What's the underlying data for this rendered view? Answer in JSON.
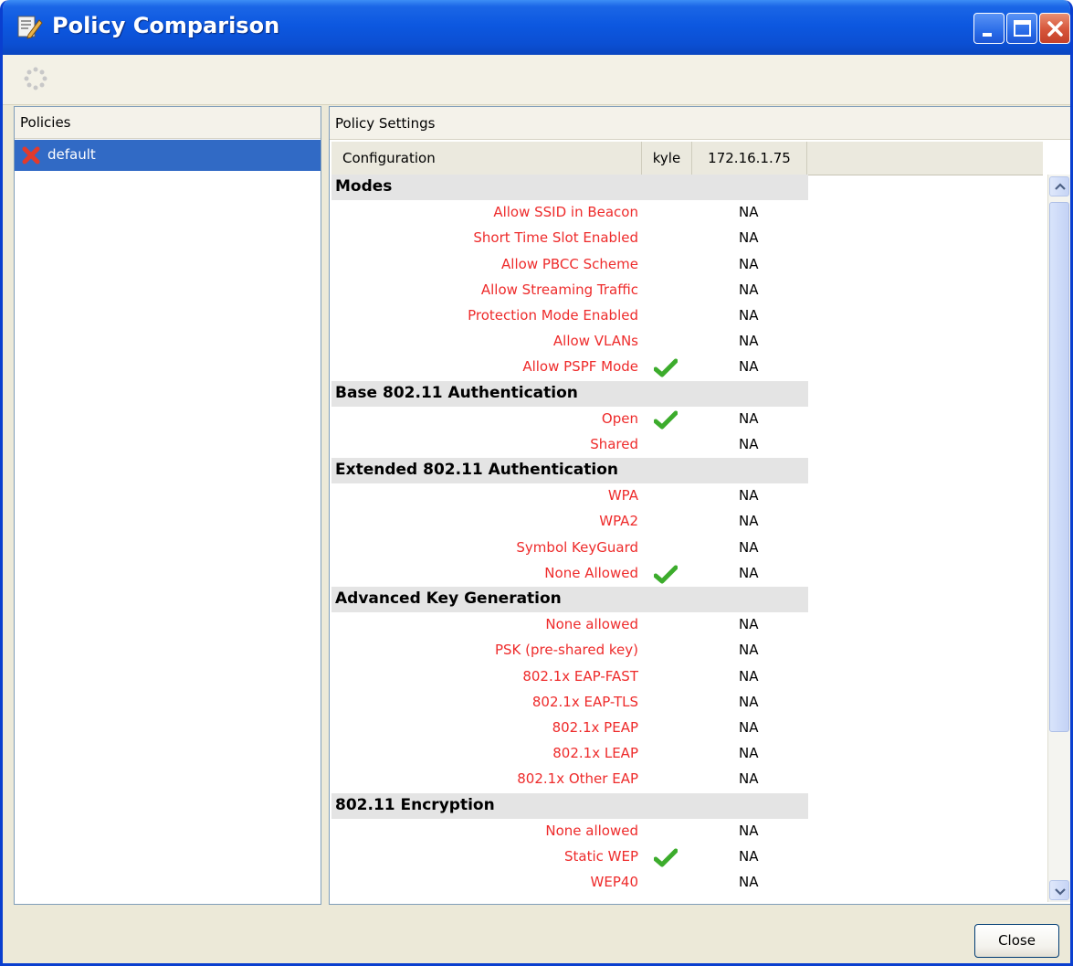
{
  "window": {
    "title": "Policy Comparison"
  },
  "left_pane": {
    "header": "Policies",
    "policies": [
      {
        "label": "default",
        "icon": "red-x-icon",
        "selected": true
      }
    ]
  },
  "right_pane": {
    "header": "Policy Settings",
    "columns": [
      "Configuration",
      "kyle",
      "172.16.1.75"
    ]
  },
  "sections": [
    {
      "title": "Modes",
      "items": [
        {
          "name": "Allow SSID in Beacon",
          "kyle": false,
          "value": "NA"
        },
        {
          "name": "Short Time Slot Enabled",
          "kyle": false,
          "value": "NA"
        },
        {
          "name": "Allow PBCC Scheme",
          "kyle": false,
          "value": "NA"
        },
        {
          "name": "Allow Streaming Traffic",
          "kyle": false,
          "value": "NA"
        },
        {
          "name": "Protection Mode Enabled",
          "kyle": false,
          "value": "NA"
        },
        {
          "name": "Allow VLANs",
          "kyle": false,
          "value": "NA"
        },
        {
          "name": "Allow PSPF Mode",
          "kyle": true,
          "value": "NA"
        }
      ]
    },
    {
      "title": "Base 802.11 Authentication",
      "items": [
        {
          "name": "Open",
          "kyle": true,
          "value": "NA"
        },
        {
          "name": "Shared",
          "kyle": false,
          "value": "NA"
        }
      ]
    },
    {
      "title": "Extended 802.11 Authentication",
      "items": [
        {
          "name": "WPA",
          "kyle": false,
          "value": "NA"
        },
        {
          "name": "WPA2",
          "kyle": false,
          "value": "NA"
        },
        {
          "name": "Symbol KeyGuard",
          "kyle": false,
          "value": "NA"
        },
        {
          "name": "None Allowed",
          "kyle": true,
          "value": "NA"
        }
      ]
    },
    {
      "title": "Advanced Key Generation",
      "items": [
        {
          "name": "None allowed",
          "kyle": false,
          "value": "NA"
        },
        {
          "name": "PSK (pre-shared key)",
          "kyle": false,
          "value": "NA"
        },
        {
          "name": "802.1x EAP-FAST",
          "kyle": false,
          "value": "NA"
        },
        {
          "name": "802.1x EAP-TLS",
          "kyle": false,
          "value": "NA"
        },
        {
          "name": "802.1x PEAP",
          "kyle": false,
          "value": "NA"
        },
        {
          "name": "802.1x LEAP",
          "kyle": false,
          "value": "NA"
        },
        {
          "name": "802.1x Other EAP",
          "kyle": false,
          "value": "NA"
        }
      ]
    },
    {
      "title": "802.11 Encryption",
      "items": [
        {
          "name": "None allowed",
          "kyle": false,
          "value": "NA"
        },
        {
          "name": "Static WEP",
          "kyle": true,
          "value": "NA"
        },
        {
          "name": "WEP40",
          "kyle": false,
          "value": "NA"
        }
      ]
    }
  ],
  "buttons": {
    "close_label": "Close"
  },
  "colors": {
    "title_bar": "#0b4fd3",
    "selection": "#316ac5",
    "setting_name": "#ee2b2b",
    "check": "#3cac2c"
  }
}
